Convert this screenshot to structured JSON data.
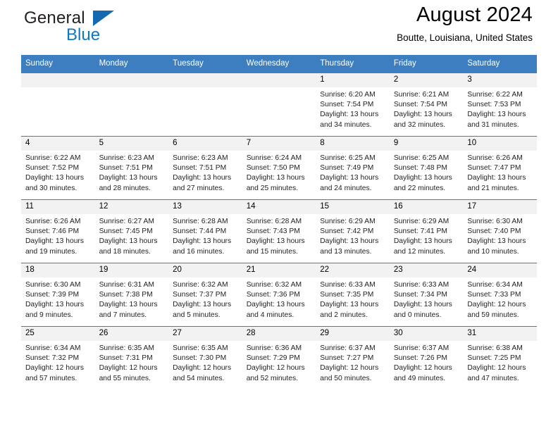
{
  "brand": {
    "name_part1": "General",
    "name_part2": "Blue",
    "logo_icon": "triangle-flag-icon"
  },
  "header": {
    "month_title": "August 2024",
    "location": "Boutte, Louisiana, United States"
  },
  "colors": {
    "header_blue": "#3c7ebf",
    "brand_blue": "#1278be",
    "daynum_band": "#f2f2f2",
    "text": "#222222"
  },
  "calendar": {
    "weekday_headers": [
      "Sunday",
      "Monday",
      "Tuesday",
      "Wednesday",
      "Thursday",
      "Friday",
      "Saturday"
    ],
    "weeks": [
      [
        {
          "day": "",
          "sunrise": "",
          "sunset": "",
          "daylight_line1": "",
          "daylight_line2": "",
          "empty": true
        },
        {
          "day": "",
          "sunrise": "",
          "sunset": "",
          "daylight_line1": "",
          "daylight_line2": "",
          "empty": true
        },
        {
          "day": "",
          "sunrise": "",
          "sunset": "",
          "daylight_line1": "",
          "daylight_line2": "",
          "empty": true
        },
        {
          "day": "",
          "sunrise": "",
          "sunset": "",
          "daylight_line1": "",
          "daylight_line2": "",
          "empty": true
        },
        {
          "day": "1",
          "sunrise": "Sunrise: 6:20 AM",
          "sunset": "Sunset: 7:54 PM",
          "daylight_line1": "Daylight: 13 hours",
          "daylight_line2": "and 34 minutes.",
          "empty": false
        },
        {
          "day": "2",
          "sunrise": "Sunrise: 6:21 AM",
          "sunset": "Sunset: 7:54 PM",
          "daylight_line1": "Daylight: 13 hours",
          "daylight_line2": "and 32 minutes.",
          "empty": false
        },
        {
          "day": "3",
          "sunrise": "Sunrise: 6:22 AM",
          "sunset": "Sunset: 7:53 PM",
          "daylight_line1": "Daylight: 13 hours",
          "daylight_line2": "and 31 minutes.",
          "empty": false
        }
      ],
      [
        {
          "day": "4",
          "sunrise": "Sunrise: 6:22 AM",
          "sunset": "Sunset: 7:52 PM",
          "daylight_line1": "Daylight: 13 hours",
          "daylight_line2": "and 30 minutes.",
          "empty": false
        },
        {
          "day": "5",
          "sunrise": "Sunrise: 6:23 AM",
          "sunset": "Sunset: 7:51 PM",
          "daylight_line1": "Daylight: 13 hours",
          "daylight_line2": "and 28 minutes.",
          "empty": false
        },
        {
          "day": "6",
          "sunrise": "Sunrise: 6:23 AM",
          "sunset": "Sunset: 7:51 PM",
          "daylight_line1": "Daylight: 13 hours",
          "daylight_line2": "and 27 minutes.",
          "empty": false
        },
        {
          "day": "7",
          "sunrise": "Sunrise: 6:24 AM",
          "sunset": "Sunset: 7:50 PM",
          "daylight_line1": "Daylight: 13 hours",
          "daylight_line2": "and 25 minutes.",
          "empty": false
        },
        {
          "day": "8",
          "sunrise": "Sunrise: 6:25 AM",
          "sunset": "Sunset: 7:49 PM",
          "daylight_line1": "Daylight: 13 hours",
          "daylight_line2": "and 24 minutes.",
          "empty": false
        },
        {
          "day": "9",
          "sunrise": "Sunrise: 6:25 AM",
          "sunset": "Sunset: 7:48 PM",
          "daylight_line1": "Daylight: 13 hours",
          "daylight_line2": "and 22 minutes.",
          "empty": false
        },
        {
          "day": "10",
          "sunrise": "Sunrise: 6:26 AM",
          "sunset": "Sunset: 7:47 PM",
          "daylight_line1": "Daylight: 13 hours",
          "daylight_line2": "and 21 minutes.",
          "empty": false
        }
      ],
      [
        {
          "day": "11",
          "sunrise": "Sunrise: 6:26 AM",
          "sunset": "Sunset: 7:46 PM",
          "daylight_line1": "Daylight: 13 hours",
          "daylight_line2": "and 19 minutes.",
          "empty": false
        },
        {
          "day": "12",
          "sunrise": "Sunrise: 6:27 AM",
          "sunset": "Sunset: 7:45 PM",
          "daylight_line1": "Daylight: 13 hours",
          "daylight_line2": "and 18 minutes.",
          "empty": false
        },
        {
          "day": "13",
          "sunrise": "Sunrise: 6:28 AM",
          "sunset": "Sunset: 7:44 PM",
          "daylight_line1": "Daylight: 13 hours",
          "daylight_line2": "and 16 minutes.",
          "empty": false
        },
        {
          "day": "14",
          "sunrise": "Sunrise: 6:28 AM",
          "sunset": "Sunset: 7:43 PM",
          "daylight_line1": "Daylight: 13 hours",
          "daylight_line2": "and 15 minutes.",
          "empty": false
        },
        {
          "day": "15",
          "sunrise": "Sunrise: 6:29 AM",
          "sunset": "Sunset: 7:42 PM",
          "daylight_line1": "Daylight: 13 hours",
          "daylight_line2": "and 13 minutes.",
          "empty": false
        },
        {
          "day": "16",
          "sunrise": "Sunrise: 6:29 AM",
          "sunset": "Sunset: 7:41 PM",
          "daylight_line1": "Daylight: 13 hours",
          "daylight_line2": "and 12 minutes.",
          "empty": false
        },
        {
          "day": "17",
          "sunrise": "Sunrise: 6:30 AM",
          "sunset": "Sunset: 7:40 PM",
          "daylight_line1": "Daylight: 13 hours",
          "daylight_line2": "and 10 minutes.",
          "empty": false
        }
      ],
      [
        {
          "day": "18",
          "sunrise": "Sunrise: 6:30 AM",
          "sunset": "Sunset: 7:39 PM",
          "daylight_line1": "Daylight: 13 hours",
          "daylight_line2": "and 9 minutes.",
          "empty": false
        },
        {
          "day": "19",
          "sunrise": "Sunrise: 6:31 AM",
          "sunset": "Sunset: 7:38 PM",
          "daylight_line1": "Daylight: 13 hours",
          "daylight_line2": "and 7 minutes.",
          "empty": false
        },
        {
          "day": "20",
          "sunrise": "Sunrise: 6:32 AM",
          "sunset": "Sunset: 7:37 PM",
          "daylight_line1": "Daylight: 13 hours",
          "daylight_line2": "and 5 minutes.",
          "empty": false
        },
        {
          "day": "21",
          "sunrise": "Sunrise: 6:32 AM",
          "sunset": "Sunset: 7:36 PM",
          "daylight_line1": "Daylight: 13 hours",
          "daylight_line2": "and 4 minutes.",
          "empty": false
        },
        {
          "day": "22",
          "sunrise": "Sunrise: 6:33 AM",
          "sunset": "Sunset: 7:35 PM",
          "daylight_line1": "Daylight: 13 hours",
          "daylight_line2": "and 2 minutes.",
          "empty": false
        },
        {
          "day": "23",
          "sunrise": "Sunrise: 6:33 AM",
          "sunset": "Sunset: 7:34 PM",
          "daylight_line1": "Daylight: 13 hours",
          "daylight_line2": "and 0 minutes.",
          "empty": false
        },
        {
          "day": "24",
          "sunrise": "Sunrise: 6:34 AM",
          "sunset": "Sunset: 7:33 PM",
          "daylight_line1": "Daylight: 12 hours",
          "daylight_line2": "and 59 minutes.",
          "empty": false
        }
      ],
      [
        {
          "day": "25",
          "sunrise": "Sunrise: 6:34 AM",
          "sunset": "Sunset: 7:32 PM",
          "daylight_line1": "Daylight: 12 hours",
          "daylight_line2": "and 57 minutes.",
          "empty": false
        },
        {
          "day": "26",
          "sunrise": "Sunrise: 6:35 AM",
          "sunset": "Sunset: 7:31 PM",
          "daylight_line1": "Daylight: 12 hours",
          "daylight_line2": "and 55 minutes.",
          "empty": false
        },
        {
          "day": "27",
          "sunrise": "Sunrise: 6:35 AM",
          "sunset": "Sunset: 7:30 PM",
          "daylight_line1": "Daylight: 12 hours",
          "daylight_line2": "and 54 minutes.",
          "empty": false
        },
        {
          "day": "28",
          "sunrise": "Sunrise: 6:36 AM",
          "sunset": "Sunset: 7:29 PM",
          "daylight_line1": "Daylight: 12 hours",
          "daylight_line2": "and 52 minutes.",
          "empty": false
        },
        {
          "day": "29",
          "sunrise": "Sunrise: 6:37 AM",
          "sunset": "Sunset: 7:27 PM",
          "daylight_line1": "Daylight: 12 hours",
          "daylight_line2": "and 50 minutes.",
          "empty": false
        },
        {
          "day": "30",
          "sunrise": "Sunrise: 6:37 AM",
          "sunset": "Sunset: 7:26 PM",
          "daylight_line1": "Daylight: 12 hours",
          "daylight_line2": "and 49 minutes.",
          "empty": false
        },
        {
          "day": "31",
          "sunrise": "Sunrise: 6:38 AM",
          "sunset": "Sunset: 7:25 PM",
          "daylight_line1": "Daylight: 12 hours",
          "daylight_line2": "and 47 minutes.",
          "empty": false
        }
      ]
    ]
  }
}
